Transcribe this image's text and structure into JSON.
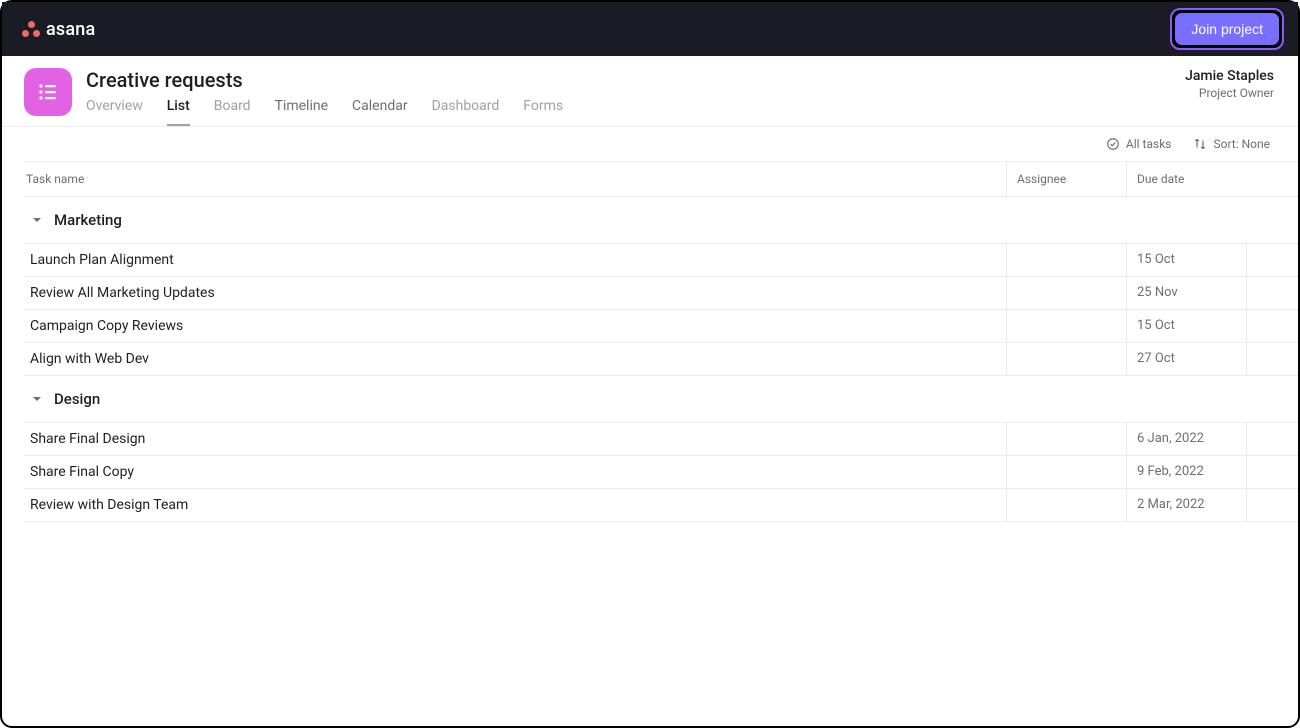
{
  "brand": {
    "name": "asana"
  },
  "cta": {
    "join_label": "Join project"
  },
  "project": {
    "title": "Creative requests",
    "tabs": [
      {
        "label": "Overview",
        "active": false,
        "muted": true
      },
      {
        "label": "List",
        "active": true,
        "muted": false
      },
      {
        "label": "Board",
        "active": false,
        "muted": true
      },
      {
        "label": "Timeline",
        "active": false,
        "muted": false
      },
      {
        "label": "Calendar",
        "active": false,
        "muted": false
      },
      {
        "label": "Dashboard",
        "active": false,
        "muted": true
      },
      {
        "label": "Forms",
        "active": false,
        "muted": true
      }
    ],
    "active_tab_index": 1
  },
  "owner": {
    "name": "Jamie Staples",
    "role": "Project Owner"
  },
  "toolbar": {
    "filter_label": "All tasks",
    "sort_label": "Sort: None"
  },
  "columns": {
    "task": "Task name",
    "assignee": "Assignee",
    "due": "Due date"
  },
  "sections": [
    {
      "name": "Marketing",
      "tasks": [
        {
          "name": "Launch Plan Alignment",
          "assignee": "",
          "due": "15 Oct"
        },
        {
          "name": "Review All Marketing Updates",
          "assignee": "",
          "due": "25 Nov"
        },
        {
          "name": "Campaign Copy Reviews",
          "assignee": "",
          "due": "15 Oct"
        },
        {
          "name": "Align with Web Dev",
          "assignee": "",
          "due": "27 Oct"
        }
      ]
    },
    {
      "name": "Design",
      "tasks": [
        {
          "name": "Share Final Design",
          "assignee": "",
          "due": "6 Jan, 2022"
        },
        {
          "name": "Share Final Copy",
          "assignee": "",
          "due": "9 Feb, 2022"
        },
        {
          "name": "Review with Design Team",
          "assignee": "",
          "due": "2 Mar, 2022"
        }
      ]
    }
  ]
}
